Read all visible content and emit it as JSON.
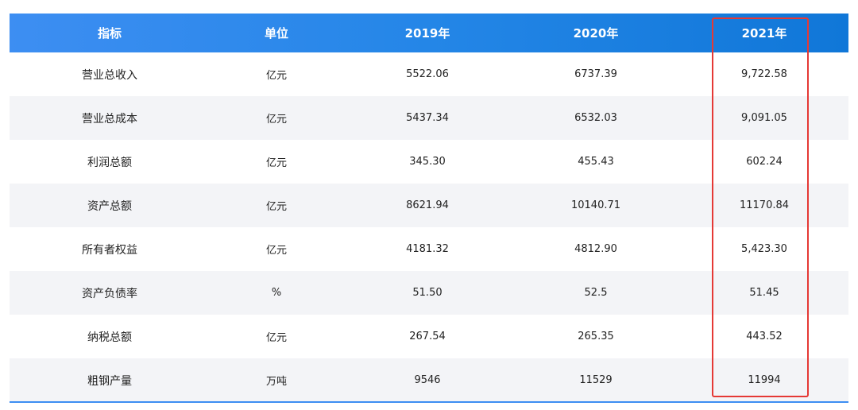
{
  "table": {
    "headers": [
      "指标",
      "单位",
      "2019年",
      "2020年",
      "2021年"
    ],
    "rows": [
      [
        "营业总收入",
        "亿元",
        "5522.06",
        "6737.39",
        "9,722.58"
      ],
      [
        "营业总成本",
        "亿元",
        "5437.34",
        "6532.03",
        "9,091.05"
      ],
      [
        "利润总额",
        "亿元",
        "345.30",
        "455.43",
        "602.24"
      ],
      [
        "资产总额",
        "亿元",
        "8621.94",
        "10140.71",
        "11170.84"
      ],
      [
        "所有者权益",
        "亿元",
        "4181.32",
        "4812.90",
        "5,423.30"
      ],
      [
        "资产负债率",
        "%",
        "51.50",
        "52.5",
        "51.45"
      ],
      [
        "纳税总额",
        "亿元",
        "267.54",
        "265.35",
        "443.52"
      ],
      [
        "粗钢产量",
        "万吨",
        "9546",
        "11529",
        "11994"
      ]
    ]
  },
  "colors": {
    "header_start": "#3d8ef2",
    "header_end": "#1077d8",
    "stripe": "#f3f4f7",
    "highlight": "#e53935"
  }
}
